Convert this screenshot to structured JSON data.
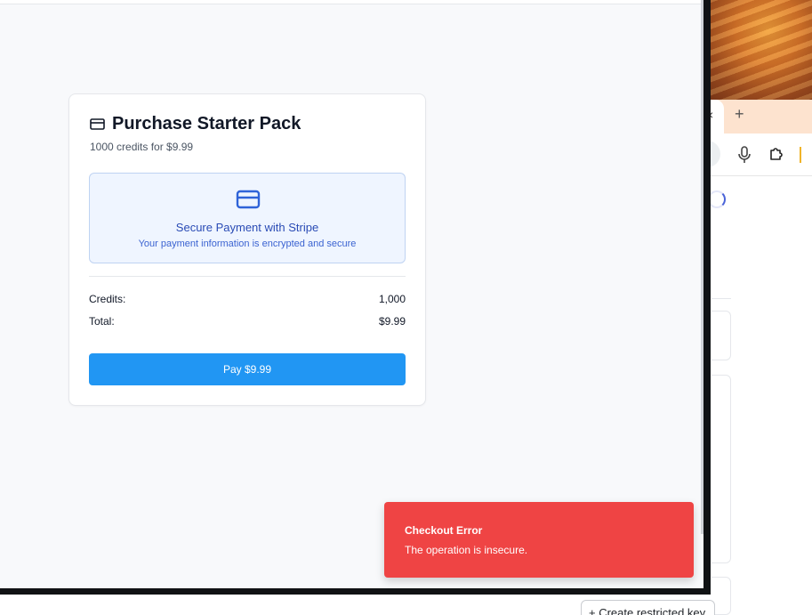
{
  "purchase": {
    "title": "Purchase Starter Pack",
    "subtitle": "1000 credits for $9.99",
    "secure_title": "Secure Payment with Stripe",
    "secure_subtitle": "Your payment information is encrypted and secure",
    "credits_label": "Credits:",
    "credits_value": "1,000",
    "total_label": "Total:",
    "total_value": "$9.99",
    "pay_button": "Pay $9.99"
  },
  "toast": {
    "title": "Checkout Error",
    "message": "The operation is insecure."
  },
  "background_browser": {
    "tab_close_glyph": "×",
    "new_tab_glyph": "+",
    "create_key_button": "+ Create restricted key"
  },
  "colors": {
    "pay_button": "#2196f3",
    "toast_error": "#ef4444",
    "secure_box_bg": "#eff5ff",
    "secure_text": "#2a4bb5"
  },
  "icons": {
    "card_title": "credit-card-icon",
    "secure_box": "credit-card-icon",
    "browser_toolbar": [
      "microphone-icon",
      "extension-puzzle-icon"
    ]
  }
}
